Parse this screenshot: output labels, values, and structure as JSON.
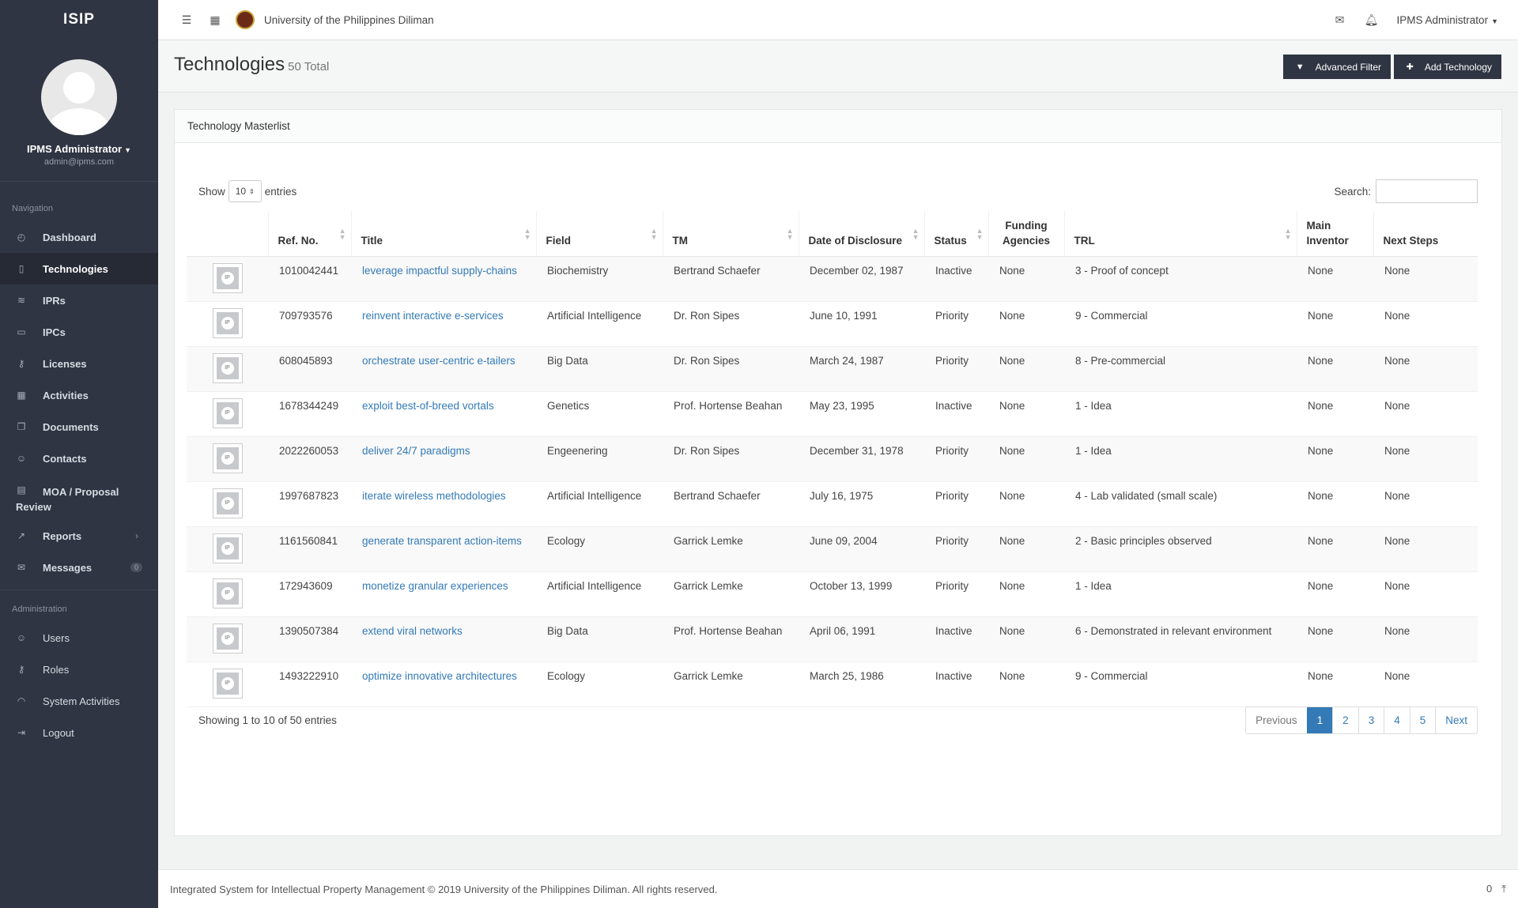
{
  "app": {
    "brand": "ISIP"
  },
  "profile": {
    "name": "IPMS Administrator",
    "email": "admin@ipms.com"
  },
  "nav": {
    "heading": "Navigation",
    "items": [
      {
        "label": "Dashboard",
        "icon": "dashboard-icon"
      },
      {
        "label": "Technologies",
        "icon": "book-icon",
        "active": true
      },
      {
        "label": "IPRs",
        "icon": "layers-icon"
      },
      {
        "label": "IPCs",
        "icon": "folder-icon"
      },
      {
        "label": "Licenses",
        "icon": "key-icon"
      },
      {
        "label": "Activities",
        "icon": "calendar-icon"
      },
      {
        "label": "Documents",
        "icon": "documents-icon"
      },
      {
        "label": "Contacts",
        "icon": "contacts-icon"
      },
      {
        "label": "MOA / Proposal Review",
        "icon": "book-icon"
      },
      {
        "label": "Reports",
        "icon": "chart-line-icon"
      },
      {
        "label": "Messages",
        "icon": "envelope-icon",
        "badge": "0"
      }
    ]
  },
  "admin": {
    "heading": "Administration",
    "items": [
      {
        "label": "Users"
      },
      {
        "label": "Roles"
      },
      {
        "label": "System Activities"
      },
      {
        "label": "Logout"
      }
    ]
  },
  "topbar": {
    "university": "University of the Philippines Diliman",
    "user": "IPMS Administrator"
  },
  "page": {
    "title": "Technologies",
    "total": "50 Total",
    "filter_label": "Advanced Filter",
    "add_label": "Add Technology"
  },
  "panel": {
    "title": "Technology Masterlist"
  },
  "table": {
    "show": "Show",
    "entries_value": "10",
    "entries": "entries",
    "search_label": "Search:",
    "columns": [
      "Ref. No.",
      "Title",
      "Field",
      "TM",
      "Date of Disclosure",
      "Status",
      "Funding Agencies",
      "TRL",
      "Main Inventor",
      "Next Steps"
    ],
    "rows": [
      [
        "1010042441",
        "leverage impactful supply-chains",
        "Biochemistry",
        "Bertrand Schaefer",
        "December 02, 1987",
        "Inactive",
        "None",
        "3 - Proof of concept",
        "None",
        "None"
      ],
      [
        "709793576",
        "reinvent interactive e-services",
        "Artificial Intelligence",
        "Dr. Ron Sipes",
        "June 10, 1991",
        "Priority",
        "None",
        "9 - Commercial",
        "None",
        "None"
      ],
      [
        "608045893",
        "orchestrate user-centric e-tailers",
        "Big Data",
        "Dr. Ron Sipes",
        "March 24, 1987",
        "Priority",
        "None",
        "8 - Pre-commercial",
        "None",
        "None"
      ],
      [
        "1678344249",
        "exploit best-of-breed vortals",
        "Genetics",
        "Prof. Hortense Beahan",
        "May 23, 1995",
        "Inactive",
        "None",
        "1 - Idea",
        "None",
        "None"
      ],
      [
        "2022260053",
        "deliver 24/7 paradigms",
        "Engeenering",
        "Dr. Ron Sipes",
        "December 31, 1978",
        "Priority",
        "None",
        "1 - Idea",
        "None",
        "None"
      ],
      [
        "1997687823",
        "iterate wireless methodologies",
        "Artificial Intelligence",
        "Bertrand Schaefer",
        "July 16, 1975",
        "Priority",
        "None",
        "4 - Lab validated (small scale)",
        "None",
        "None"
      ],
      [
        "1161560841",
        "generate transparent action-items",
        "Ecology",
        "Garrick Lemke",
        "June 09, 2004",
        "Priority",
        "None",
        "2 - Basic principles observed",
        "None",
        "None"
      ],
      [
        "172943609",
        "monetize granular experiences",
        "Artificial Intelligence",
        "Garrick Lemke",
        "October 13, 1999",
        "Priority",
        "None",
        "1 - Idea",
        "None",
        "None"
      ],
      [
        "1390507384",
        "extend viral networks",
        "Big Data",
        "Prof. Hortense Beahan",
        "April 06, 1991",
        "Inactive",
        "None",
        "6 - Demonstrated in relevant environment",
        "None",
        "None"
      ],
      [
        "1493222910",
        "optimize innovative architectures",
        "Ecology",
        "Garrick Lemke",
        "March 25, 1986",
        "Inactive",
        "None",
        "9 - Commercial",
        "None",
        "None"
      ]
    ],
    "info": "Showing 1 to 10 of 50 entries",
    "pager": [
      "Previous",
      "1",
      "2",
      "3",
      "4",
      "5",
      "Next"
    ]
  },
  "footer": {
    "text": "Integrated System for Intellectual Property Management © 2019 University of the Philippines Diliman. All rights reserved.",
    "count": "0"
  }
}
